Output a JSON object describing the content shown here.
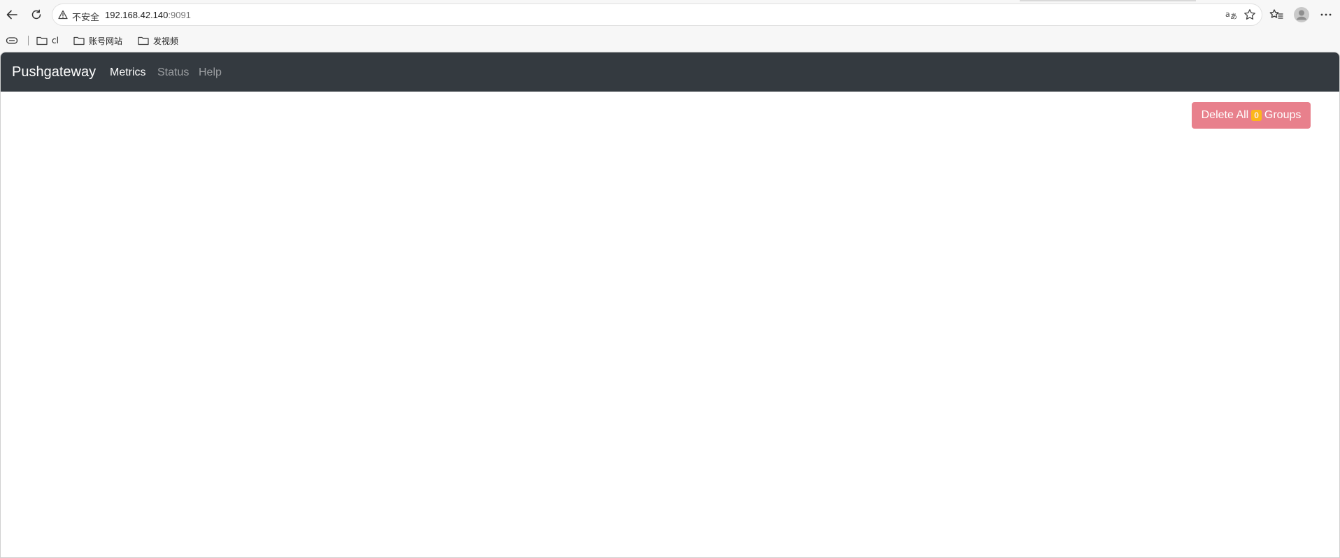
{
  "browser": {
    "security_label": "不安全",
    "url_host": "192.168.42.140",
    "url_port": ":9091",
    "icons": [
      "back-icon",
      "reload-icon",
      "warning-icon",
      "read-aloud-icon",
      "favorite-star-icon",
      "favorites-list-icon",
      "profile-avatar-icon",
      "more-menu-icon"
    ]
  },
  "bookmarks": {
    "items": [
      {
        "label": "cl"
      },
      {
        "label": "账号网站"
      },
      {
        "label": "发视频"
      }
    ]
  },
  "navbar": {
    "brand": "Pushgateway",
    "links": [
      {
        "label": "Metrics",
        "active": true
      },
      {
        "label": "Status",
        "active": false
      },
      {
        "label": "Help",
        "active": false
      }
    ]
  },
  "actions": {
    "delete_prefix": "Delete All",
    "group_count": "0",
    "delete_suffix": "Groups"
  },
  "colors": {
    "navbar_bg": "#343a40",
    "delete_button_bg": "#e8808c",
    "badge_bg": "#ffc107"
  }
}
